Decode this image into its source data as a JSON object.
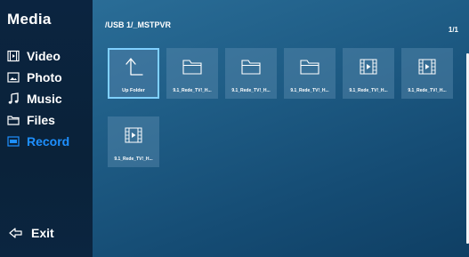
{
  "sidebar": {
    "title": "Media",
    "items": [
      {
        "label": "Video",
        "icon": "video-icon"
      },
      {
        "label": "Photo",
        "icon": "photo-icon"
      },
      {
        "label": "Music",
        "icon": "music-icon"
      },
      {
        "label": "Files",
        "icon": "folder-icon"
      },
      {
        "label": "Record",
        "icon": "record-icon",
        "active": true
      }
    ],
    "exit_label": "Exit"
  },
  "browser": {
    "path": "/USB 1/_MSTPVR",
    "page": "1/1",
    "items": [
      {
        "label": "Up Folder",
        "type": "up-folder",
        "selected": true
      },
      {
        "label": "9.1_Rede_TV!_H...",
        "type": "folder"
      },
      {
        "label": "9.1_Rede_TV!_H...",
        "type": "folder"
      },
      {
        "label": "9.1_Rede_TV!_H...",
        "type": "folder"
      },
      {
        "label": "9.1_Rede_TV!_H...",
        "type": "video"
      },
      {
        "label": "9.1_Rede_TV!_H...",
        "type": "video"
      },
      {
        "label": "9.1_Rede_TV!_H...",
        "type": "video"
      }
    ]
  },
  "colors": {
    "active_menu": "#1e90ff",
    "selection_border": "#7fd0ff",
    "sidebar_bg": "#0b2440",
    "main_bg": "#1f5d86"
  }
}
